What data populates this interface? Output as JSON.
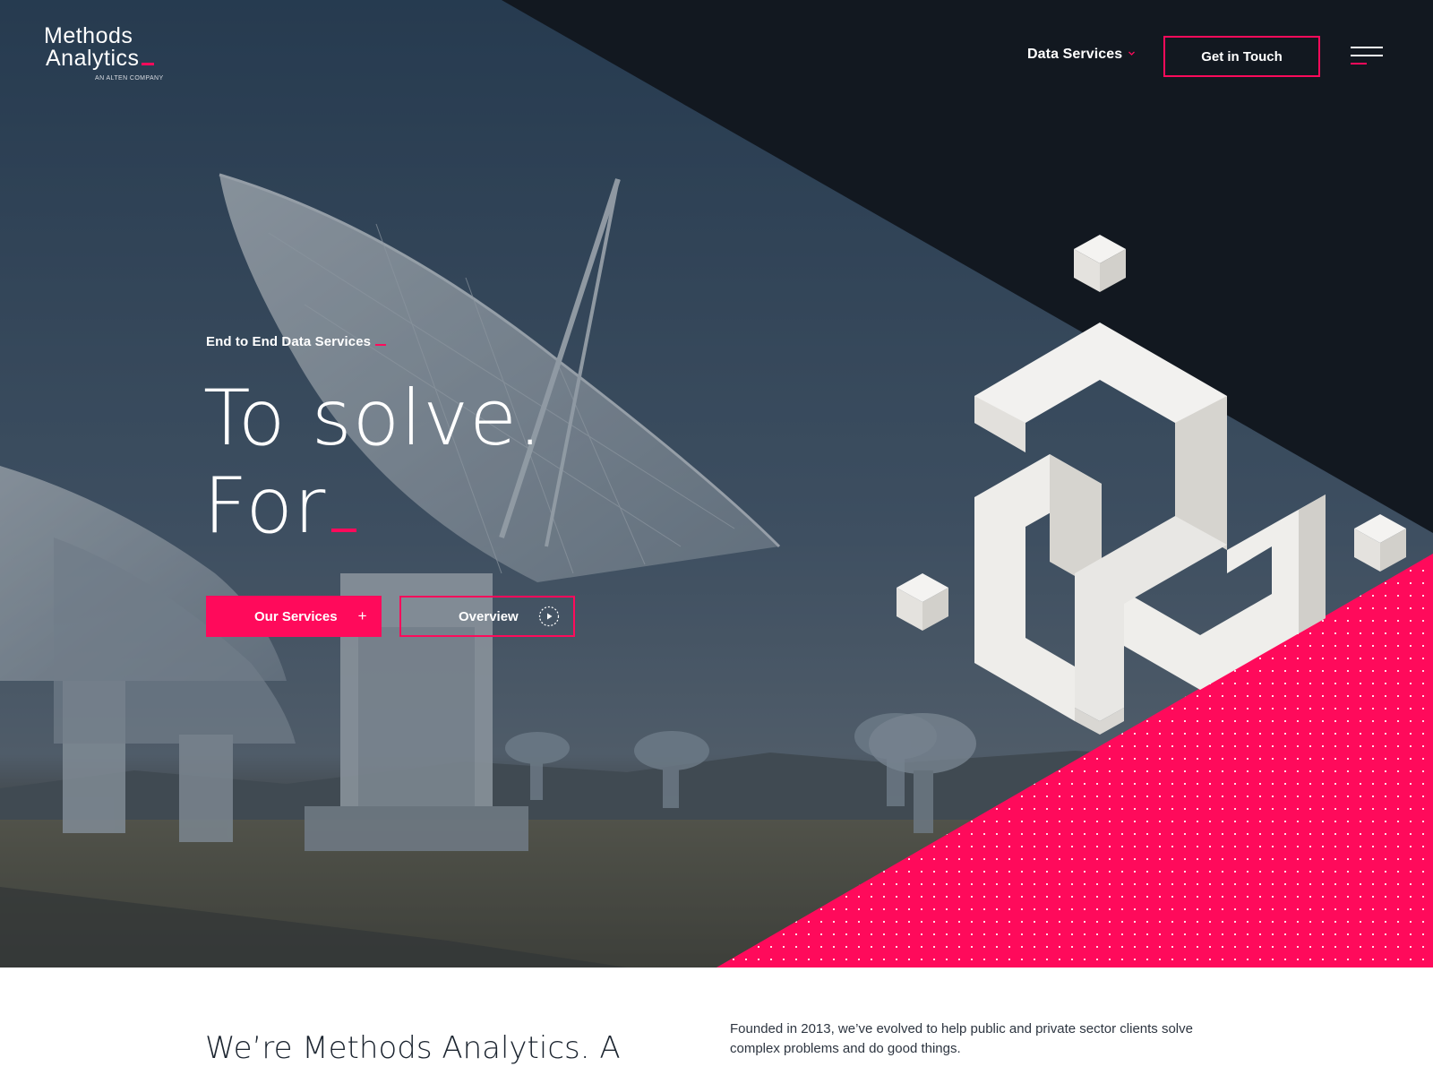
{
  "brand": {
    "name_line1": "Methods",
    "name_line2": "Analytics",
    "tagline": "AN ALTEN COMPANY",
    "accent_color": "#ff0a5b",
    "dark_color": "#121820"
  },
  "nav": {
    "services_label": "Data Services",
    "contact_label": "Get in Touch",
    "menu_icon": "hamburger-menu-icon",
    "dropdown_icon": "chevron-down-icon"
  },
  "hero": {
    "eyebrow": "End to End Data Services",
    "headline_line1": "To solve.",
    "headline_line2": "For",
    "primary_button": "Our Services",
    "primary_icon": "plus-icon",
    "secondary_button": "Overview",
    "secondary_icon": "play-circle-icon",
    "background": "radio telescope dishes array photo"
  },
  "intro": {
    "title": "We’re Methods Analytics. A",
    "text": "Founded in 2013, we’ve evolved to help public and private sector clients solve complex problems and do good things."
  }
}
